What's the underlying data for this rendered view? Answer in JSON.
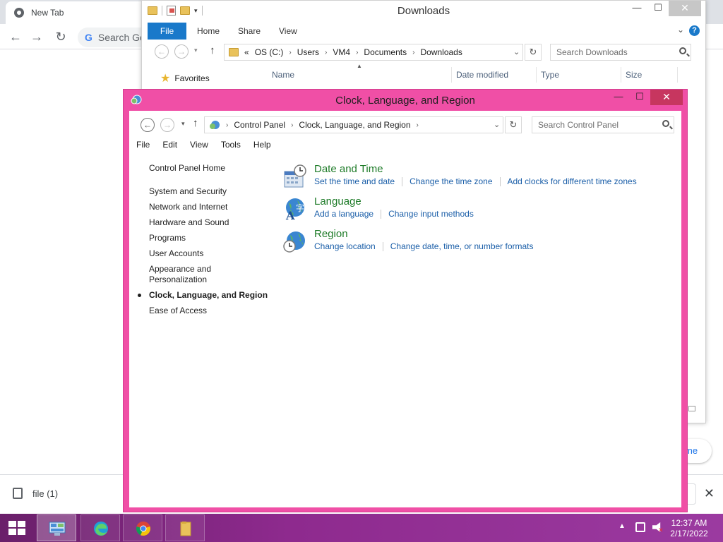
{
  "chrome": {
    "tab_title": "New Tab",
    "omnibox_placeholder": "Search Go",
    "pill_text": "me",
    "download_file": "file (1)"
  },
  "explorer": {
    "title": "Downloads",
    "ribbon_tabs": [
      "File",
      "Home",
      "Share",
      "View"
    ],
    "breadcrumb": [
      "«",
      "OS (C:)",
      "Users",
      "VM4",
      "Documents",
      "Downloads"
    ],
    "search_placeholder": "Search Downloads",
    "nav_favorites": "Favorites",
    "columns": [
      "Name",
      "Date modified",
      "Type",
      "Size"
    ]
  },
  "control_panel": {
    "title": "Clock, Language, and Region",
    "breadcrumb": [
      "Control Panel",
      "Clock, Language, and Region"
    ],
    "search_placeholder": "Search Control Panel",
    "menu": [
      "File",
      "Edit",
      "View",
      "Tools",
      "Help"
    ],
    "left_nav": {
      "home": "Control Panel Home",
      "items": [
        "System and Security",
        "Network and Internet",
        "Hardware and Sound",
        "Programs",
        "User Accounts",
        "Appearance and Personalization",
        "Clock, Language, and Region",
        "Ease of Access"
      ],
      "active_index": 6
    },
    "sections": [
      {
        "title": "Date and Time",
        "icon": "calendar-clock-icon",
        "links": [
          "Set the time and date",
          "Change the time zone",
          "Add clocks for different time zones"
        ]
      },
      {
        "title": "Language",
        "icon": "globe-language-icon",
        "links": [
          "Add a language",
          "Change input methods"
        ]
      },
      {
        "title": "Region",
        "icon": "globe-clock-icon",
        "links": [
          "Change location",
          "Change date, time, or number formats"
        ]
      }
    ],
    "colors": {
      "frame": "#f04fa6",
      "section_title": "#1e7b28",
      "link": "#1a5ea8"
    }
  },
  "taskbar": {
    "time": "12:37 AM",
    "date": "2/17/2022",
    "apps": [
      "control-panel-icon",
      "edge-icon",
      "chrome-icon",
      "file-explorer-icon"
    ]
  }
}
